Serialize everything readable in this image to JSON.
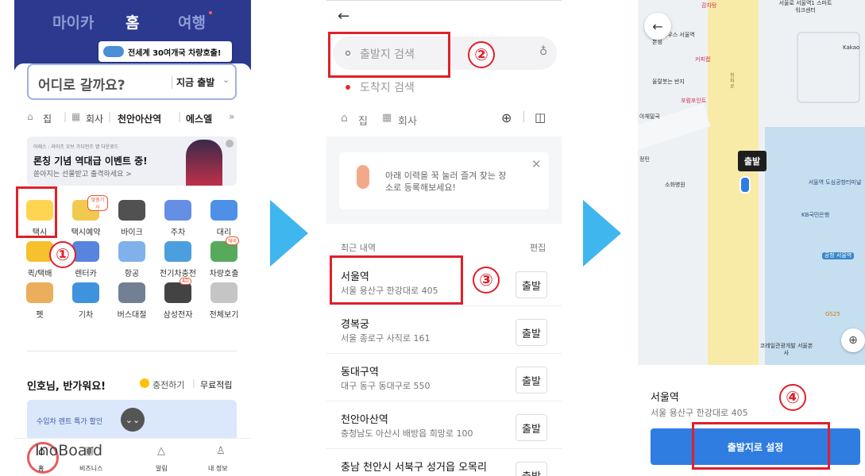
{
  "arrows": {
    "color": "#3fb6ee"
  },
  "steps": [
    "①",
    "②",
    "③",
    "④"
  ],
  "panel1": {
    "tabs": [
      "마이카",
      "홈",
      "여행"
    ],
    "promo_banner": "전세계 30여개국 차량호출!",
    "search": {
      "placeholder": "어디로 갈까요?",
      "time_label": "지금 출발"
    },
    "shortcuts": [
      "집",
      "회사",
      "천안아산역",
      "에스엘"
    ],
    "ad": {
      "sponsor": "아레스 : 라이즈 오브 가디언즈 앱 다운로드",
      "title": "론칭 기념 역대급 이벤트 중!",
      "sub": "쏟아지는 선물받고 출격하세요 >"
    },
    "services": [
      {
        "label": "택시",
        "badge": ""
      },
      {
        "label": "택시예약",
        "badge": "맞춤기사"
      },
      {
        "label": "바이크",
        "badge": ""
      },
      {
        "label": "주차",
        "badge": ""
      },
      {
        "label": "대리",
        "badge": ""
      },
      {
        "label": "퀵/택배",
        "badge": ""
      },
      {
        "label": "렌터카",
        "badge": ""
      },
      {
        "label": "항공",
        "badge": ""
      },
      {
        "label": "전기차충전",
        "badge": ""
      },
      {
        "label": "차량호출",
        "badge": "해외"
      },
      {
        "label": "펫",
        "badge": ""
      },
      {
        "label": "기차",
        "badge": ""
      },
      {
        "label": "버스대절",
        "badge": ""
      },
      {
        "label": "삼성전자",
        "badge": "AD"
      },
      {
        "label": "전체보기",
        "badge": ""
      }
    ],
    "greeting": "인호님, 반가워요!",
    "charge": "충전하기",
    "points": "무료적립",
    "card_text": "수입차 렌트 특가 할인",
    "bottom_nav": [
      "홈",
      "비즈니스",
      "알림",
      "내 정보"
    ],
    "watermark": "InoBoard"
  },
  "panel2": {
    "origin_placeholder": "출발지 검색",
    "dest_placeholder": "도착지 검색",
    "shortcuts": [
      "집",
      "회사"
    ],
    "tip": "아래 이력을 꾹 눌러 즐겨 찾는 장소로 등록해보세요!",
    "recent_label": "최근 내역",
    "edit_label": "편집",
    "depart_label": "출발",
    "recent": [
      {
        "name": "서울역",
        "addr": "서울 용산구 한강대로 405"
      },
      {
        "name": "경복궁",
        "addr": "서울 종로구 사직로 161"
      },
      {
        "name": "동대구역",
        "addr": "대구 동구 동대구로 550"
      },
      {
        "name": "천안아산역",
        "addr": "충청남도 아산시 배방읍 희망로 100"
      },
      {
        "name": "충남 천안시 서북구 성거읍 오목리",
        "addr": ""
      }
    ]
  },
  "panel3": {
    "map_labels": [
      "감자탕",
      "서울로 서울역1 스마트 워크센터",
      "레터하우스 서울역본점",
      "커피랩",
      "울랄붓는 반지",
      "포럼포인트",
      "아체밀국",
      "정민",
      "소화병원",
      "서울역 도심공항터미널",
      "KB국민은행",
      "공항 서울역",
      "GS25",
      "코레일관광개발 서울본사",
      "Kakao",
      "청파로"
    ],
    "pin_label": "출발",
    "place_name": "서울역",
    "place_addr": "서울 용산구 한강대로 405",
    "set_button": "출발지로 설정"
  }
}
